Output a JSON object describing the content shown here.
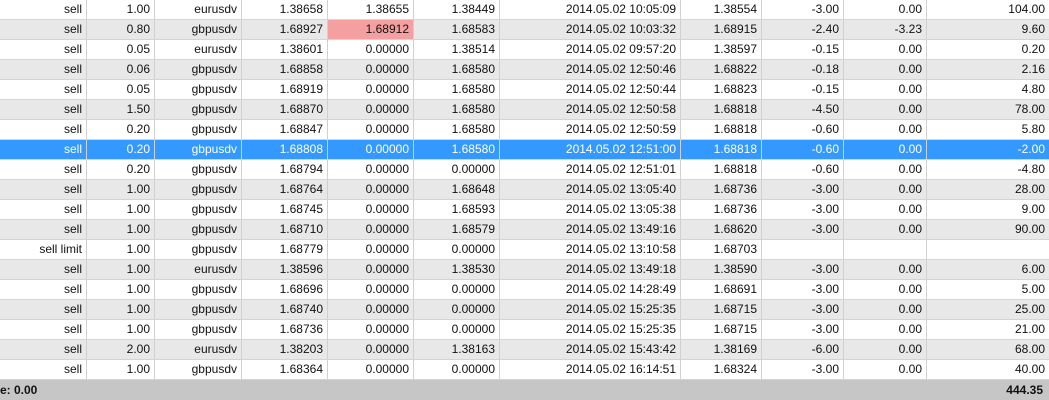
{
  "colors": {
    "selected": "#3399ff",
    "highlight": "#f4a0a0",
    "alt_row": "#e8e8e8"
  },
  "selected_row": 7,
  "rows": [
    {
      "type": "sell",
      "volume": "1.00",
      "symbol": "eurusdv",
      "price": "1.38658",
      "sl": "1.38655",
      "tp": "1.38449",
      "time": "2014.05.02 10:05:09",
      "close_price": "1.38554",
      "commission": "-3.00",
      "swap": "0.00",
      "profit": "104.00"
    },
    {
      "type": "sell",
      "volume": "0.80",
      "symbol": "gbpusdv",
      "price": "1.68927",
      "sl": "1.68912",
      "tp": "1.68583",
      "time": "2014.05.02 10:03:32",
      "close_price": "1.68915",
      "commission": "-2.40",
      "swap": "-3.23",
      "profit": "9.60",
      "sl_highlight": true
    },
    {
      "type": "sell",
      "volume": "0.05",
      "symbol": "eurusdv",
      "price": "1.38601",
      "sl": "0.00000",
      "tp": "1.38514",
      "time": "2014.05.02 09:57:20",
      "close_price": "1.38597",
      "commission": "-0.15",
      "swap": "0.00",
      "profit": "0.20"
    },
    {
      "type": "sell",
      "volume": "0.06",
      "symbol": "gbpusdv",
      "price": "1.68858",
      "sl": "0.00000",
      "tp": "1.68580",
      "time": "2014.05.02 12:50:46",
      "close_price": "1.68822",
      "commission": "-0.18",
      "swap": "0.00",
      "profit": "2.16"
    },
    {
      "type": "sell",
      "volume": "0.05",
      "symbol": "gbpusdv",
      "price": "1.68919",
      "sl": "0.00000",
      "tp": "1.68580",
      "time": "2014.05.02 12:50:44",
      "close_price": "1.68823",
      "commission": "-0.15",
      "swap": "0.00",
      "profit": "4.80"
    },
    {
      "type": "sell",
      "volume": "1.50",
      "symbol": "gbpusdv",
      "price": "1.68870",
      "sl": "0.00000",
      "tp": "1.68580",
      "time": "2014.05.02 12:50:58",
      "close_price": "1.68818",
      "commission": "-4.50",
      "swap": "0.00",
      "profit": "78.00"
    },
    {
      "type": "sell",
      "volume": "0.20",
      "symbol": "gbpusdv",
      "price": "1.68847",
      "sl": "0.00000",
      "tp": "1.68580",
      "time": "2014.05.02 12:50:59",
      "close_price": "1.68818",
      "commission": "-0.60",
      "swap": "0.00",
      "profit": "5.80"
    },
    {
      "type": "sell",
      "volume": "0.20",
      "symbol": "gbpusdv",
      "price": "1.68808",
      "sl": "0.00000",
      "tp": "1.68580",
      "time": "2014.05.02 12:51:00",
      "close_price": "1.68818",
      "commission": "-0.60",
      "swap": "0.00",
      "profit": "-2.00"
    },
    {
      "type": "sell",
      "volume": "0.20",
      "symbol": "gbpusdv",
      "price": "1.68794",
      "sl": "0.00000",
      "tp": "0.00000",
      "time": "2014.05.02 12:51:01",
      "close_price": "1.68818",
      "commission": "-0.60",
      "swap": "0.00",
      "profit": "-4.80"
    },
    {
      "type": "sell",
      "volume": "1.00",
      "symbol": "gbpusdv",
      "price": "1.68764",
      "sl": "0.00000",
      "tp": "1.68648",
      "time": "2014.05.02 13:05:40",
      "close_price": "1.68736",
      "commission": "-3.00",
      "swap": "0.00",
      "profit": "28.00"
    },
    {
      "type": "sell",
      "volume": "1.00",
      "symbol": "gbpusdv",
      "price": "1.68745",
      "sl": "0.00000",
      "tp": "1.68593",
      "time": "2014.05.02 13:05:38",
      "close_price": "1.68736",
      "commission": "-3.00",
      "swap": "0.00",
      "profit": "9.00"
    },
    {
      "type": "sell",
      "volume": "1.00",
      "symbol": "gbpusdv",
      "price": "1.68710",
      "sl": "0.00000",
      "tp": "1.68579",
      "time": "2014.05.02 13:49:16",
      "close_price": "1.68620",
      "commission": "-3.00",
      "swap": "0.00",
      "profit": "90.00"
    },
    {
      "type": "sell limit",
      "volume": "1.00",
      "symbol": "gbpusdv",
      "price": "1.68779",
      "sl": "0.00000",
      "tp": "0.00000",
      "time": "2014.05.02 13:10:58",
      "close_price": "1.68703",
      "commission": "",
      "swap": "",
      "profit": ""
    },
    {
      "type": "sell",
      "volume": "1.00",
      "symbol": "eurusdv",
      "price": "1.38596",
      "sl": "0.00000",
      "tp": "1.38530",
      "time": "2014.05.02 13:49:18",
      "close_price": "1.38590",
      "commission": "-3.00",
      "swap": "0.00",
      "profit": "6.00"
    },
    {
      "type": "sell",
      "volume": "1.00",
      "symbol": "gbpusdv",
      "price": "1.68696",
      "sl": "0.00000",
      "tp": "0.00000",
      "time": "2014.05.02 14:28:49",
      "close_price": "1.68691",
      "commission": "-3.00",
      "swap": "0.00",
      "profit": "5.00"
    },
    {
      "type": "sell",
      "volume": "1.00",
      "symbol": "gbpusdv",
      "price": "1.68740",
      "sl": "0.00000",
      "tp": "0.00000",
      "time": "2014.05.02 15:25:35",
      "close_price": "1.68715",
      "commission": "-3.00",
      "swap": "0.00",
      "profit": "25.00"
    },
    {
      "type": "sell",
      "volume": "1.00",
      "symbol": "gbpusdv",
      "price": "1.68736",
      "sl": "0.00000",
      "tp": "0.00000",
      "time": "2014.05.02 15:25:35",
      "close_price": "1.68715",
      "commission": "-3.00",
      "swap": "0.00",
      "profit": "21.00"
    },
    {
      "type": "sell",
      "volume": "2.00",
      "symbol": "eurusdv",
      "price": "1.38203",
      "sl": "0.00000",
      "tp": "1.38163",
      "time": "2014.05.02 15:43:42",
      "close_price": "1.38169",
      "commission": "-6.00",
      "swap": "0.00",
      "profit": "68.00"
    },
    {
      "type": "sell",
      "volume": "1.00",
      "symbol": "gbpusdv",
      "price": "1.68364",
      "sl": "0.00000",
      "tp": "0.00000",
      "time": "2014.05.02 16:14:51",
      "close_price": "1.68324",
      "commission": "-3.00",
      "swap": "0.00",
      "profit": "40.00"
    }
  ],
  "summary": {
    "left_text": "e: 0.00",
    "total_profit": "444.35"
  }
}
